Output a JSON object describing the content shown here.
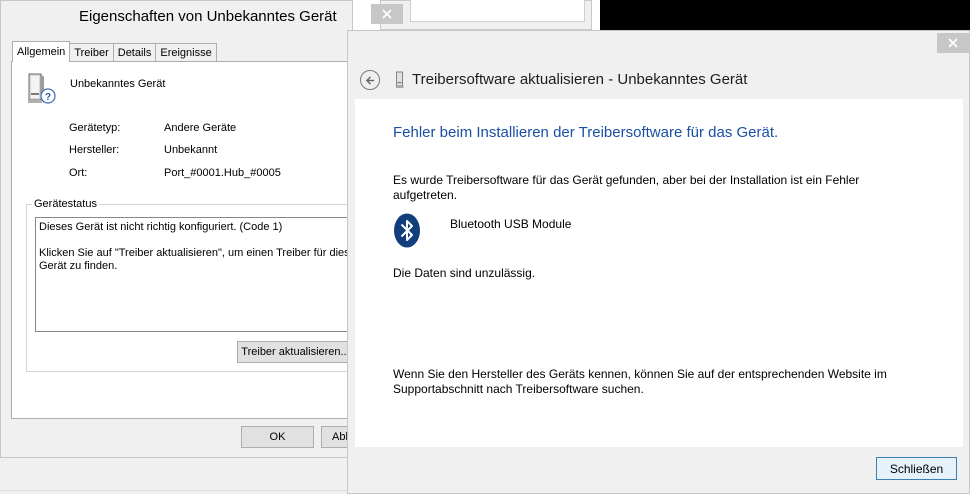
{
  "properties_dialog": {
    "title": "Eigenschaften von Unbekanntes Gerät",
    "tabs": [
      {
        "label": "Allgemein"
      },
      {
        "label": "Treiber"
      },
      {
        "label": "Details"
      },
      {
        "label": "Ereignisse"
      }
    ],
    "device_name": "Unbekanntes Gerät",
    "fields": [
      {
        "label": "Gerätetyp:",
        "value": "Andere Geräte"
      },
      {
        "label": "Hersteller:",
        "value": "Unbekannt"
      },
      {
        "label": "Ort:",
        "value": "Port_#0001.Hub_#0005"
      }
    ],
    "status_group_label": "Gerätestatus",
    "status_line1": "Dieses Gerät ist nicht richtig konfiguriert. (Code 1)",
    "status_line2a": "Klicken Sie auf \"Treiber aktualisieren\", um einen Treiber für dieses",
    "status_line2b": "Gerät zu finden.",
    "update_button": "Treiber aktualisieren...",
    "ok_button": "OK",
    "cancel_button_partial": "Abb"
  },
  "wizard_dialog": {
    "title": "Treibersoftware aktualisieren - Unbekanntes Gerät",
    "heading": "Fehler beim Installieren der Treibersoftware für das Gerät.",
    "message_line1": "Es wurde Treibersoftware für das Gerät gefunden, aber bei der Installation ist ein Fehler",
    "message_line2": "aufgetreten.",
    "device_name": "Bluetooth USB Module",
    "error_text": "Die Daten sind unzulässig.",
    "hint_line1": "Wenn Sie den Hersteller des Geräts kennen, können Sie auf der entsprechenden Website im",
    "hint_line2": "Supportabschnitt nach Treibersoftware suchen.",
    "close_button": "Schließen"
  },
  "icons": {
    "device": "unknown-device-icon",
    "bluetooth": "bluetooth-icon",
    "back": "back-arrow-icon",
    "close": "close-icon"
  },
  "colors": {
    "heading_blue": "#1a4fa3",
    "bluetooth_blue": "#123f7c",
    "dialog_bg": "#f0f0f0"
  }
}
